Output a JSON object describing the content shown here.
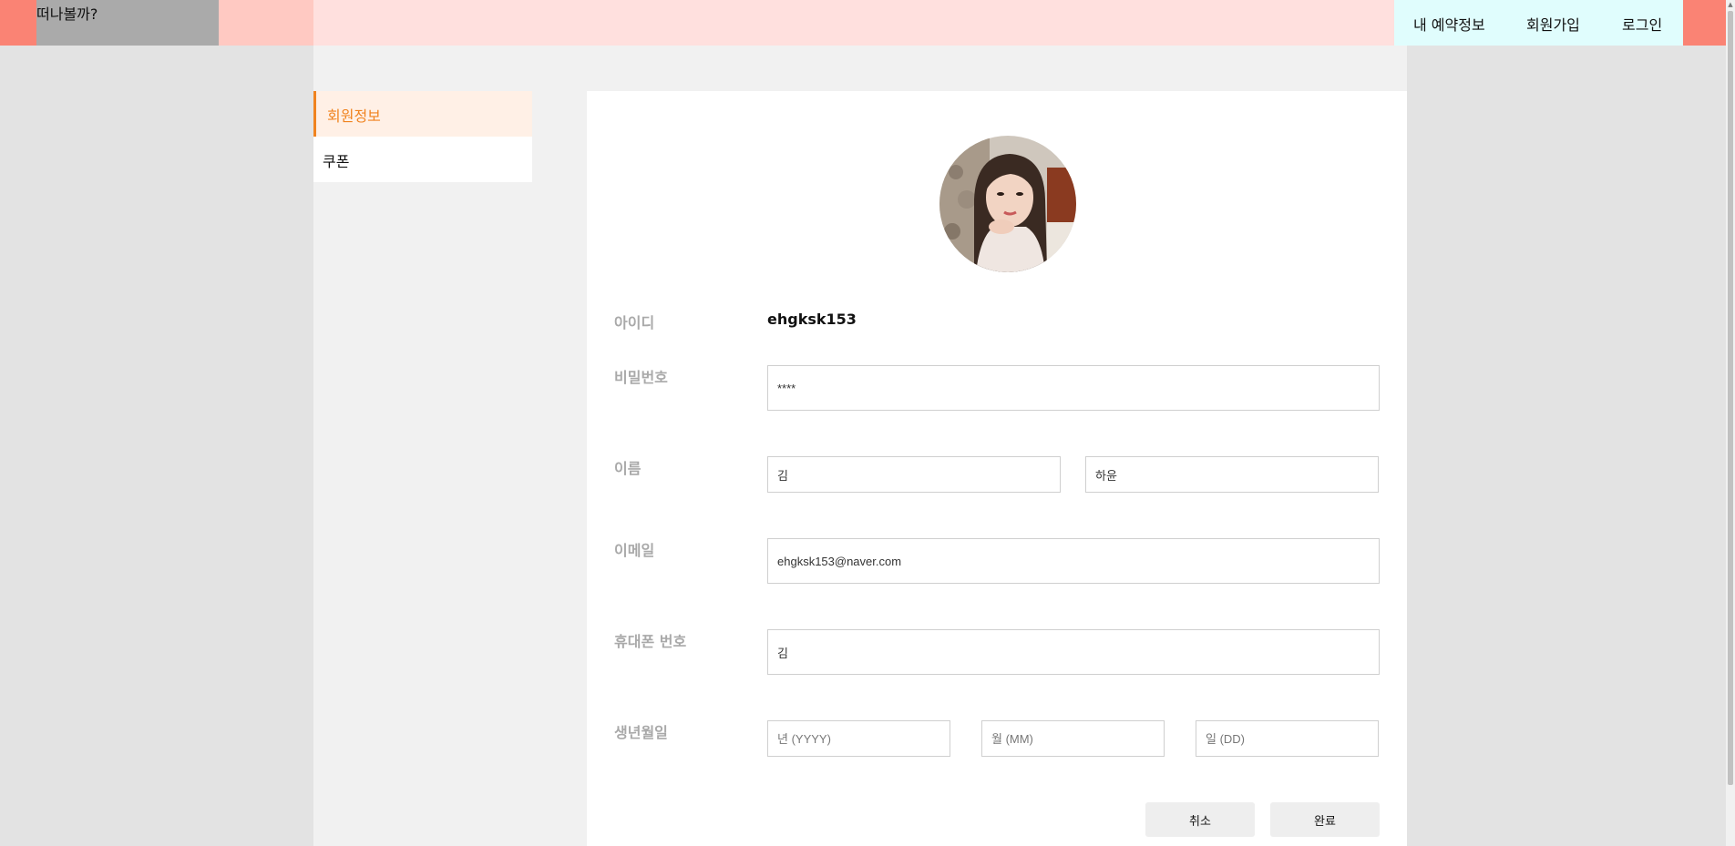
{
  "header": {
    "logo_text": "떠나볼까?",
    "nav": {
      "reservations": "내 예약정보",
      "signup": "회원가입",
      "login": "로그인"
    }
  },
  "sidebar": {
    "items": [
      {
        "label": "회원정보",
        "active": true
      },
      {
        "label": "쿠폰",
        "active": false
      }
    ]
  },
  "profile": {
    "labels": {
      "id": "아이디",
      "password": "비밀번호",
      "name": "이름",
      "email": "이메일",
      "phone": "휴대폰 번호",
      "birth": "생년월일"
    },
    "user_id": "ehgksk153",
    "fields": {
      "password_value": "****",
      "last_name_value": "김",
      "first_name_value": "하윤",
      "email_value": "ehgksk153@naver.com",
      "phone_value": "김",
      "birth_year_placeholder": "년 (YYYY)",
      "birth_month_placeholder": "월 (MM)",
      "birth_day_placeholder": "일 (DD)"
    },
    "buttons": {
      "cancel": "취소",
      "done": "완료"
    }
  },
  "colors": {
    "accent": "#f0831f",
    "header_bg": "#ffe0de",
    "header_accent": "#fa8374",
    "nav_bg": "#e0fdfd"
  }
}
